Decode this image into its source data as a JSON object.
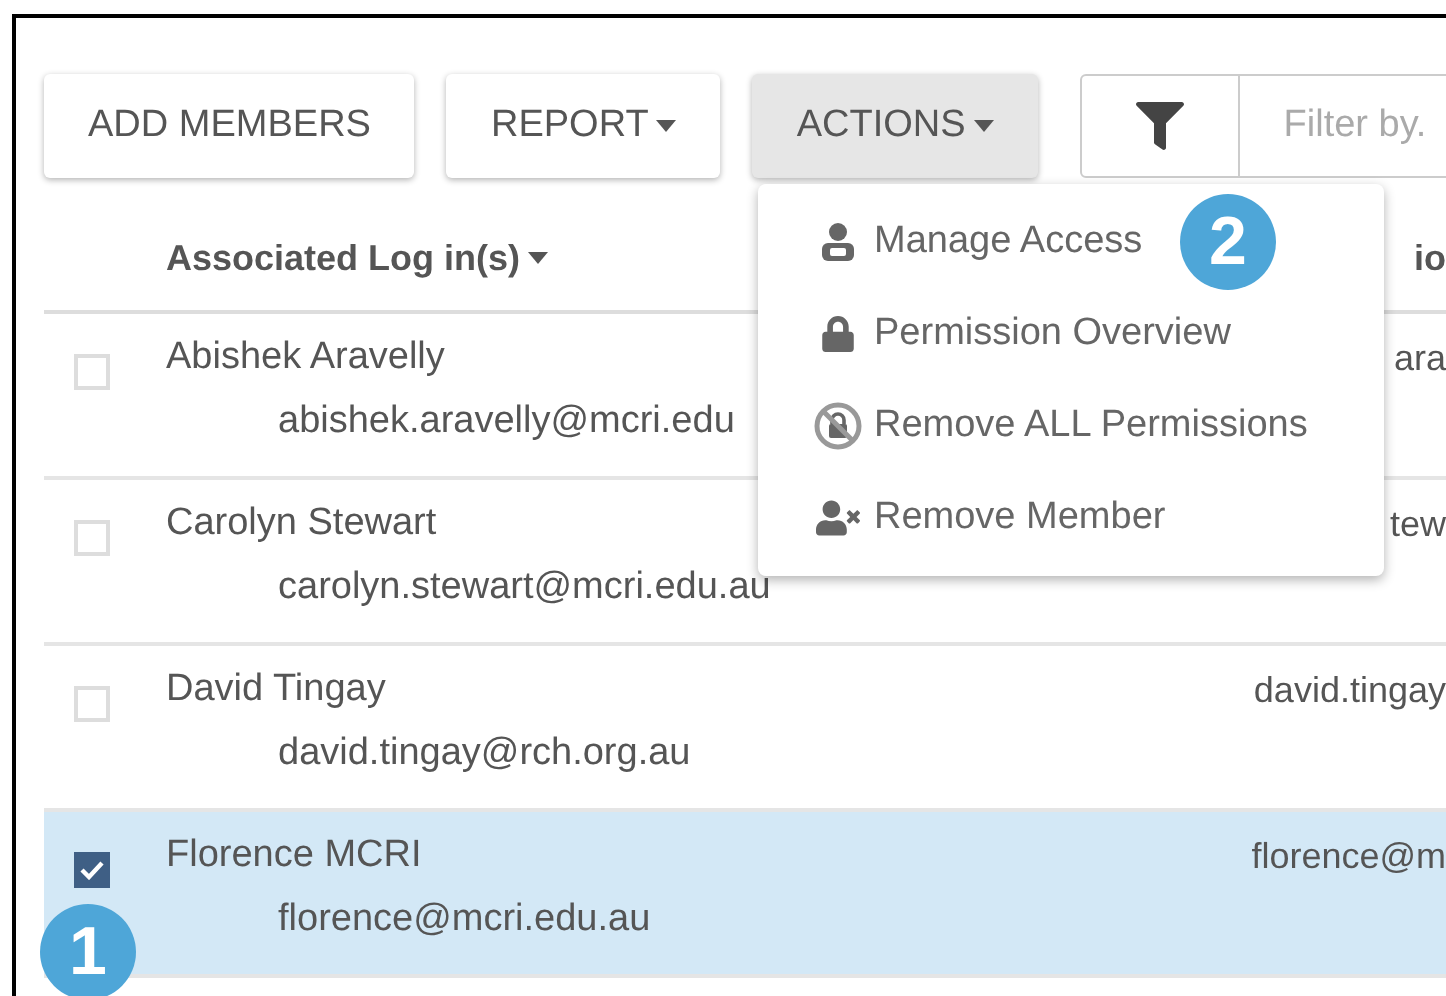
{
  "toolbar": {
    "buttons": [
      {
        "label": "ADD MEMBERS",
        "has_caret": false,
        "pressed": false
      },
      {
        "label": "REPORT",
        "has_caret": true,
        "pressed": false
      },
      {
        "label": "ACTIONS",
        "has_caret": true,
        "pressed": true
      }
    ],
    "filter": {
      "placeholder": "Filter by."
    }
  },
  "table": {
    "columns": [
      {
        "label": "Associated Log in(s)",
        "sortable": true
      },
      {
        "label": "io",
        "sortable": false
      }
    ],
    "rows": [
      {
        "name": "Abishek Aravelly",
        "email": "abishek.aravelly@mcri.edu",
        "selected": false,
        "column_2": "ara"
      },
      {
        "name": "Carolyn Stewart",
        "email": "carolyn.stewart@mcri.edu.au",
        "selected": false,
        "column_2": "tew"
      },
      {
        "name": "David Tingay",
        "email": "david.tingay@rch.org.au",
        "selected": false,
        "column_2": "david.tingay"
      },
      {
        "name": "Florence MCRI",
        "email": "florence@mcri.edu.au",
        "selected": true,
        "column_2": "florence@m"
      }
    ]
  },
  "actions_menu": {
    "items": [
      {
        "kind": "manage-access",
        "label": "Manage Access"
      },
      {
        "kind": "permission-overview",
        "label": "Permission Overview"
      },
      {
        "kind": "remove-all",
        "label": "Remove ALL Permissions"
      },
      {
        "kind": "remove-member",
        "label": "Remove Member"
      }
    ]
  },
  "annotations": [
    {
      "label": "1"
    },
    {
      "label": "2"
    }
  ]
}
